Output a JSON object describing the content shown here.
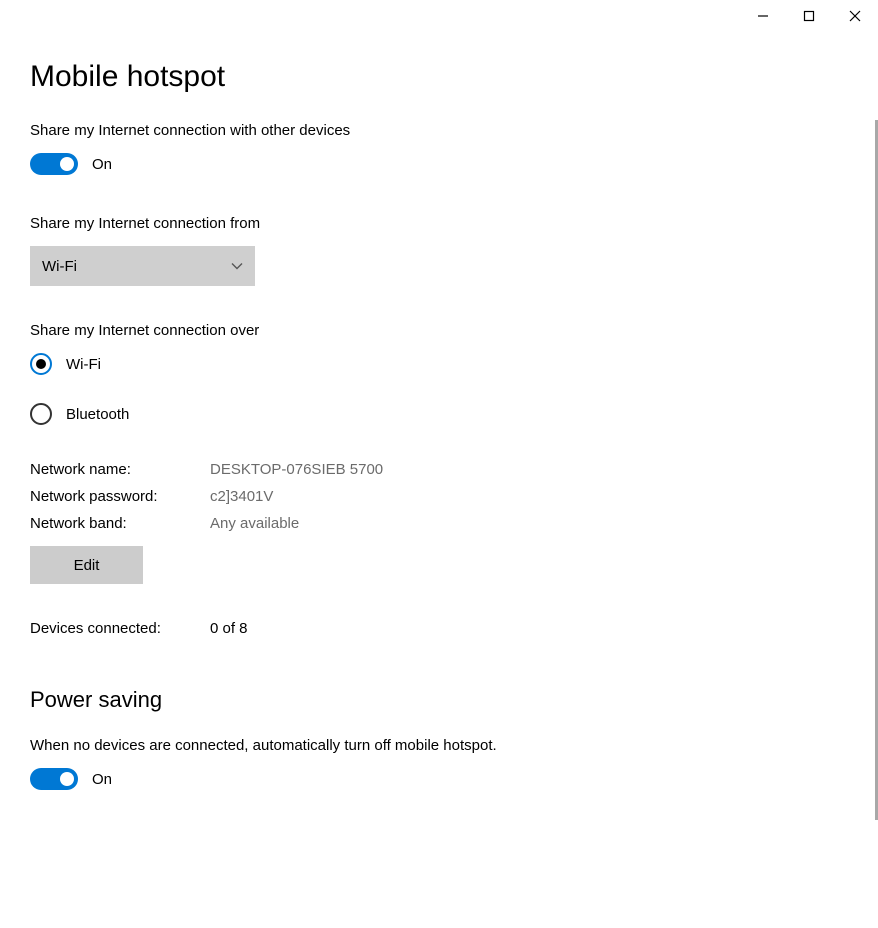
{
  "page_title": "Mobile hotspot",
  "share_connection": {
    "label": "Share my Internet connection with other devices",
    "status": "On"
  },
  "share_from": {
    "label": "Share my Internet connection from",
    "selected": "Wi-Fi"
  },
  "share_over": {
    "label": "Share my Internet connection over",
    "options": {
      "wifi": "Wi-Fi",
      "bluetooth": "Bluetooth"
    }
  },
  "network_info": {
    "name_label": "Network name:",
    "name_value": "DESKTOP-076SIEB 5700",
    "password_label": "Network password:",
    "password_value": "c2]3401V",
    "band_label": "Network band:",
    "band_value": "Any available"
  },
  "edit_btn": "Edit",
  "devices": {
    "label": "Devices connected:",
    "value": "0 of 8"
  },
  "power_saving": {
    "title": "Power saving",
    "label": "When no devices are connected, automatically turn off mobile hotspot.",
    "status": "On"
  }
}
